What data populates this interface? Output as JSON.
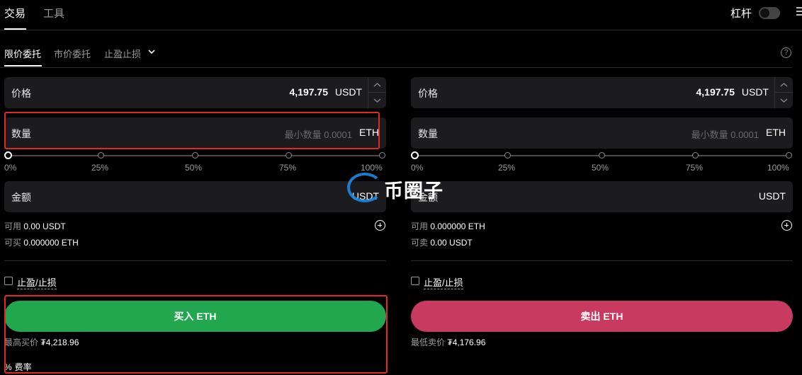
{
  "top_tabs": {
    "trade": "交易",
    "tools": "工具"
  },
  "leverage": {
    "label": "杠杆",
    "enabled": false
  },
  "order_types": {
    "limit": "限价委托",
    "market": "市价委托",
    "tpsl": "止盈止损"
  },
  "buy": {
    "price_label": "价格",
    "price_value": "4,197.75",
    "price_unit": "USDT",
    "qty_label": "数量",
    "qty_placeholder": "最小数量 0.0001",
    "qty_unit": "ETH",
    "slider_labels": [
      "0%",
      "25%",
      "50%",
      "75%",
      "100%"
    ],
    "slider_value_pct": 0,
    "amount_label": "金额",
    "amount_unit": "USDT",
    "avail_label": "可用",
    "avail_value": "0.00 USDT",
    "can_label": "可买",
    "can_value": "0.000000 ETH",
    "tpsl_label": "止盈/止损",
    "button_label": "买入 ETH",
    "best_label": "最高买价",
    "best_value": "₮4,218.96",
    "fee_icon": "%",
    "fee_label": "费率"
  },
  "sell": {
    "price_label": "价格",
    "price_value": "4,197.75",
    "price_unit": "USDT",
    "qty_label": "数量",
    "qty_placeholder": "最小数量 0.0001",
    "qty_unit": "ETH",
    "slider_labels": [
      "0%",
      "25%",
      "50%",
      "75%",
      "100%"
    ],
    "slider_value_pct": 0,
    "amount_label": "金额",
    "amount_unit": "USDT",
    "avail_label": "可用",
    "avail_value": "0.000000 ETH",
    "can_label": "可卖",
    "can_value": "0.00 USDT",
    "tpsl_label": "止盈/止损",
    "button_label": "卖出 ETH",
    "best_label": "最低卖价",
    "best_value": "₮4,176.96"
  },
  "watermark": "币圈子",
  "colors": {
    "buy": "#22a74e",
    "sell": "#c93a60",
    "highlight": "#e02a20"
  }
}
